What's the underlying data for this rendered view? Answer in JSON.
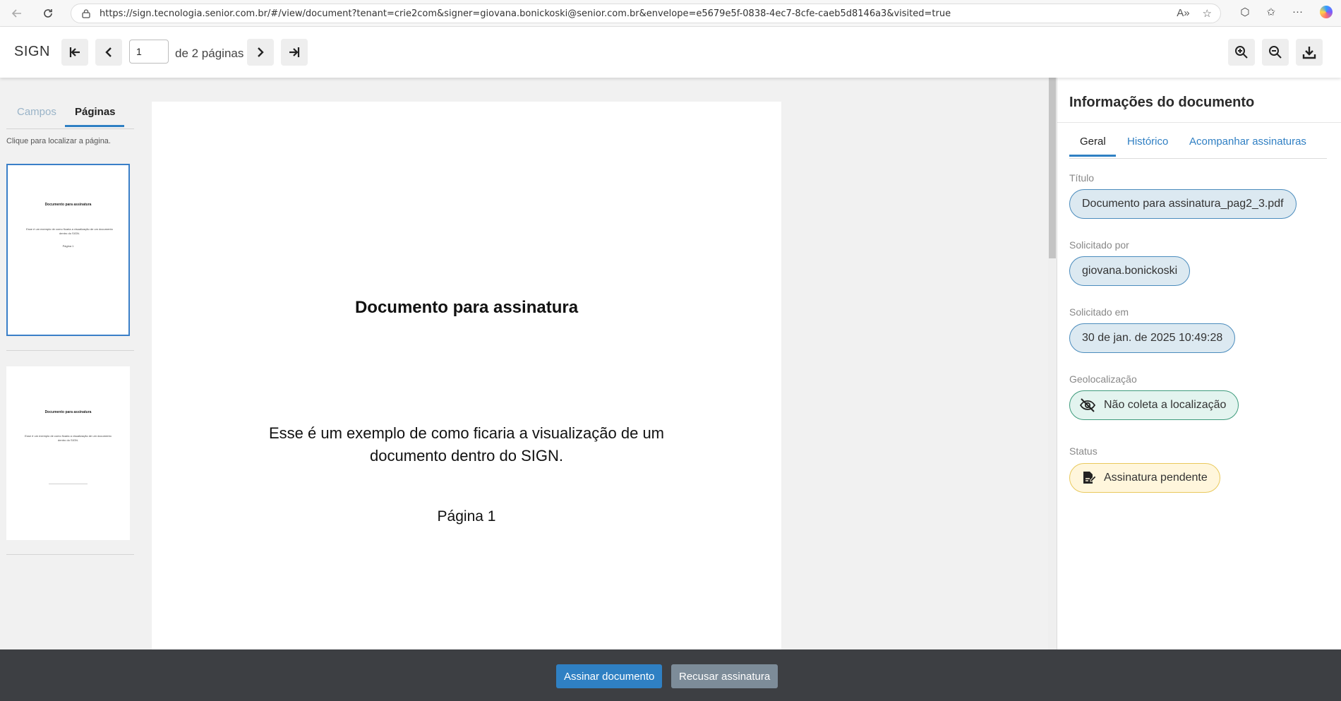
{
  "browser": {
    "url": "https://sign.tecnologia.senior.com.br/#/view/document?tenant=crie2com&signer=giovana.bonickoski@senior.com.br&envelope=e5679e5f-0838-4ec7-8cfe-caeb5d8146a3&visited=true"
  },
  "toolbar": {
    "app_name": "SIGN",
    "page_value": "1",
    "of_pages": "de 2 páginas"
  },
  "left_panel": {
    "tab_campos": "Campos",
    "tab_paginas": "Páginas",
    "hint": "Clique para localizar a página.",
    "thumb1": {
      "title": "Documento para assinatura",
      "body": "Esse é um exemplo de como ficaria a visualização de um documento dentro do SIGN.",
      "page": "Página 1"
    },
    "thumb2": {
      "title": "Documento para assinatura",
      "body": "Esse é um exemplo de como ficaria a visualização de um documento dentro do SIGN."
    }
  },
  "document": {
    "title": "Documento para assinatura",
    "body": "Esse é um exemplo de como ficaria a visualização de um documento dentro do SIGN.",
    "page_label": "Página 1"
  },
  "info": {
    "title": "Informações do documento",
    "tabs": {
      "geral": "Geral",
      "historico": "Histórico",
      "acompanhar": "Acompanhar assinaturas"
    },
    "fields": {
      "titulo_label": "Título",
      "titulo_value": "Documento para assinatura_pag2_3.pdf",
      "solicitado_por_label": "Solicitado por",
      "solicitado_por_value": "giovana.bonickoski",
      "solicitado_em_label": "Solicitado em",
      "solicitado_em_value": "30 de jan. de 2025 10:49:28",
      "geo_label": "Geolocalização",
      "geo_value": "Não coleta a localização",
      "status_label": "Status",
      "status_value": "Assinatura pendente"
    }
  },
  "footer": {
    "sign_label": "Assinar documento",
    "refuse_label": "Recusar assinatura"
  },
  "colors": {
    "accent": "#2f80c3",
    "footer_bg": "#3d3f43",
    "pill_blue_bg": "#dce9f1",
    "pill_green_bg": "#e3f4ef",
    "pill_yellow_bg": "#fff6dc"
  }
}
